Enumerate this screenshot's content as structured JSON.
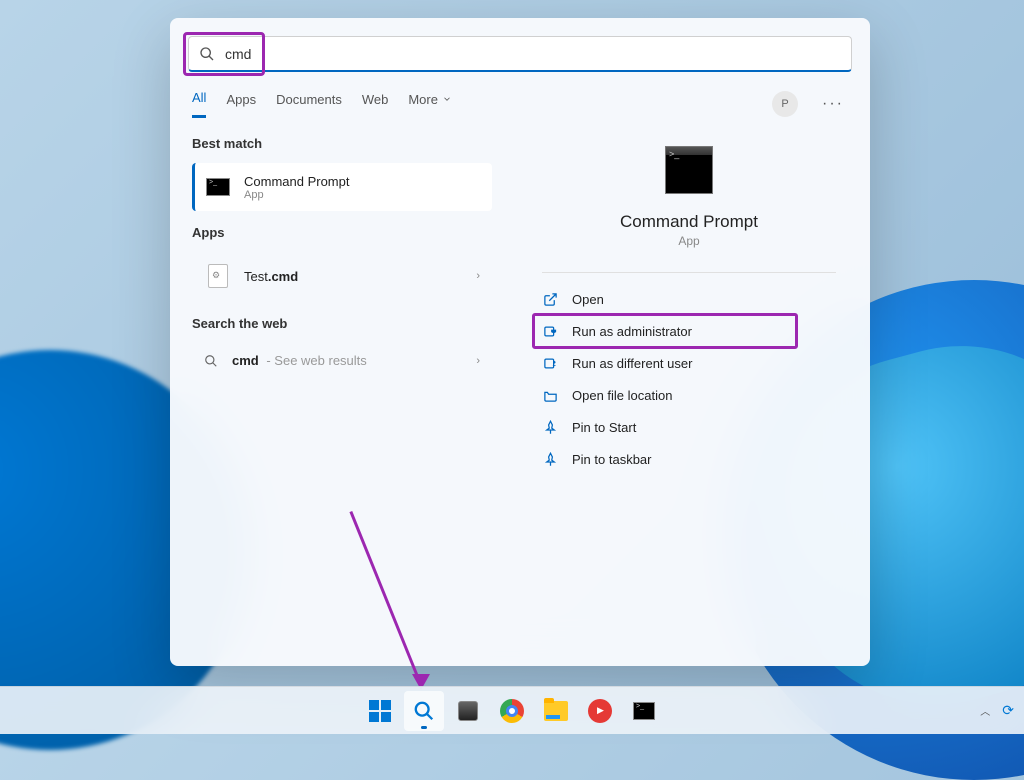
{
  "search": {
    "value": "cmd"
  },
  "tabs": {
    "all": "All",
    "apps": "Apps",
    "documents": "Documents",
    "web": "Web",
    "more": "More"
  },
  "avatar_initial": "P",
  "sections": {
    "best_match": "Best match",
    "apps": "Apps",
    "web": "Search the web"
  },
  "best_result": {
    "title": "Command Prompt",
    "subtitle": "App"
  },
  "app_results": [
    {
      "prefix": "Test",
      "suffix": ".cmd"
    }
  ],
  "web_result": {
    "term": "cmd",
    "suffix": " - See web results"
  },
  "detail": {
    "title": "Command Prompt",
    "subtitle": "App"
  },
  "actions": {
    "open": "Open",
    "run_admin": "Run as administrator",
    "run_diff": "Run as different user",
    "open_loc": "Open file location",
    "pin_start": "Pin to Start",
    "pin_taskbar": "Pin to taskbar"
  }
}
